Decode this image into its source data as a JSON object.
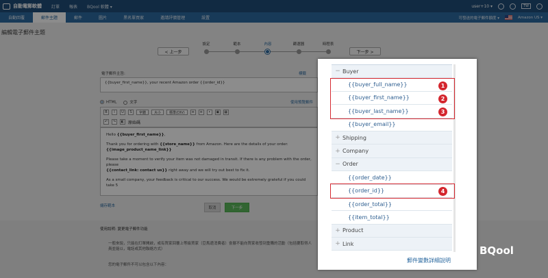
{
  "topbar": {
    "logo_text": "自動電郵軟體",
    "nav": [
      "訂單",
      "報表",
      "BQool 軟體 ▾"
    ],
    "user": "user+10 ▾",
    "badge": "TW"
  },
  "subnav": {
    "items": [
      "自動回覆",
      "郵件主題",
      "郵件",
      "圖片",
      "黑名單買家",
      "邀請評價管理",
      "設置"
    ],
    "active_index": 1,
    "right_hint": "可發送的電子郵件額度 ▾",
    "marketplace": "Amazon US ▾"
  },
  "page": {
    "title": "編輯電子郵件主題"
  },
  "stepper": {
    "prev_label": "< 上一步",
    "next_label": "下一步 >",
    "steps": [
      "設定",
      "範本",
      "內容",
      "篩選器",
      "時程表"
    ],
    "active_index": 2
  },
  "form": {
    "subject_label": "電子郵件主旨:",
    "subject_value": "{{buyer_first_name}}, your recent Amazon order {{order_id}}",
    "tag_hint": "標籤",
    "mode_html": "HTML",
    "mode_text": "文字",
    "preview_link": "使用預覽郵件",
    "font_select": "字體",
    "size_select": "大小",
    "format_select": "標準(DIV)",
    "source_label": "原始碼"
  },
  "editor": {
    "greeting_prefix": "Hello ",
    "greeting_tag": "{{buyer_first_name}}",
    "greeting_suffix": ",",
    "p1_prefix": "Thank you for ordering with ",
    "p1_tag": "{{store_name}}",
    "p1_suffix": " from Amazon. Here are the details of your order:",
    "p1_line2": "{{image_product_name_link}}",
    "p2_line1": "Please take a moment to verify your item was not damaged in transit. If there is any problem with the order, please",
    "p2_tag": "{{contact_link: contact us}}",
    "p2_suffix": " right away and we will try out best to fix it.",
    "p3": "As a small company, your feedback is critical to our success. We would be extremely grateful if you could take 5"
  },
  "actions": {
    "template_link": "儲存範本",
    "cancel_label": "取消",
    "next_label": "下一步"
  },
  "info": {
    "title": "使用說明: 變更電子郵件功能",
    "body": "一般來說，只能在訂單開啟，或有買家回覆上等級買家（亞馬遜消費者）會展不能向買家收發到重購的活動（包括要取得人員並能以，電話或其他聯絡方式）",
    "foot": "您的電子郵件不可以包含以下內容："
  },
  "tag_panel": {
    "groups": [
      {
        "label": "Buyer",
        "icon": "minus",
        "tags": [
          "{{buyer_full_name}}",
          "{{buyer_first_name}}",
          "{{buyer_last_name}}",
          "{{buyer_email}}"
        ]
      },
      {
        "label": "Shipping",
        "icon": "plus",
        "tags": []
      },
      {
        "label": "Company",
        "icon": "plus",
        "tags": []
      },
      {
        "label": "Order",
        "icon": "minus",
        "tags": [
          "{{order_date}}",
          "{{order_id}}",
          "{{order_total}}",
          "{{item_total}}"
        ]
      },
      {
        "label": "Product",
        "icon": "plus",
        "tags": []
      },
      {
        "label": "Link",
        "icon": "plus",
        "tags": []
      }
    ],
    "footer_link": "郵件變數詳細說明",
    "highlight_numbers": [
      "1",
      "2",
      "3",
      "4"
    ],
    "highlight_color": "#d4262e"
  },
  "watermark": {
    "text": "BQool"
  }
}
